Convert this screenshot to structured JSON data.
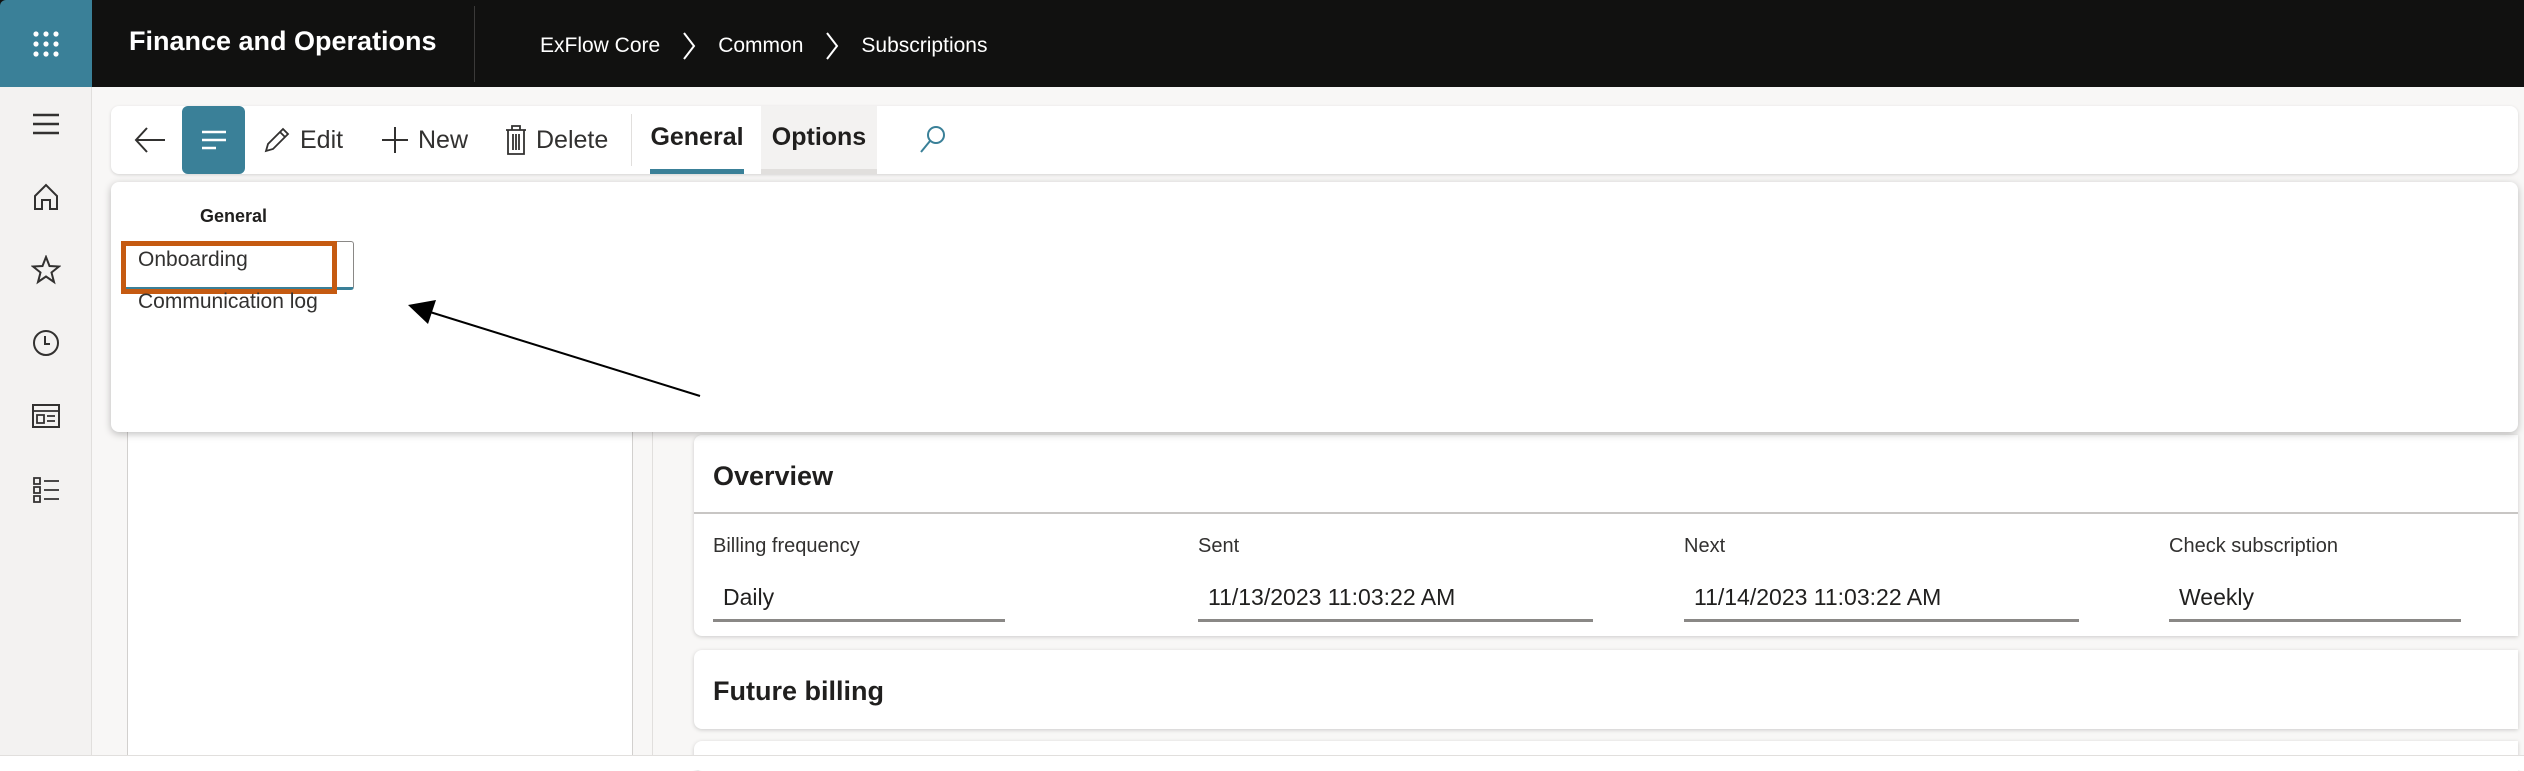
{
  "app": {
    "title": "Finance and Operations",
    "brand_color": "#3a8098",
    "waffle_icon": "waffle-icon"
  },
  "breadcrumb": [
    "ExFlow Core",
    "Common",
    "Subscriptions"
  ],
  "rail": {
    "icons": [
      "hamburger-icon",
      "home-icon",
      "star-icon",
      "clock-icon",
      "workspace-icon",
      "list-icon"
    ]
  },
  "toolbar": {
    "edit": "Edit",
    "new": "New",
    "delete": "Delete",
    "tabs": [
      {
        "label": "General",
        "active": true
      },
      {
        "label": "Options",
        "active": false
      }
    ]
  },
  "flyout": {
    "heading": "General",
    "items": [
      "Onboarding",
      "Communication log"
    ],
    "highlight_color": "#c55a11"
  },
  "overview": {
    "title": "Overview",
    "fields": [
      {
        "label": "Billing frequency",
        "value": "Daily"
      },
      {
        "label": "Sent",
        "value": "11/13/2023 11:03:22 AM"
      },
      {
        "label": "Next",
        "value": "11/14/2023 11:03:22 AM"
      },
      {
        "label": "Check subscription",
        "value": "Weekly"
      }
    ]
  },
  "future_billing": {
    "title": "Future billing"
  }
}
